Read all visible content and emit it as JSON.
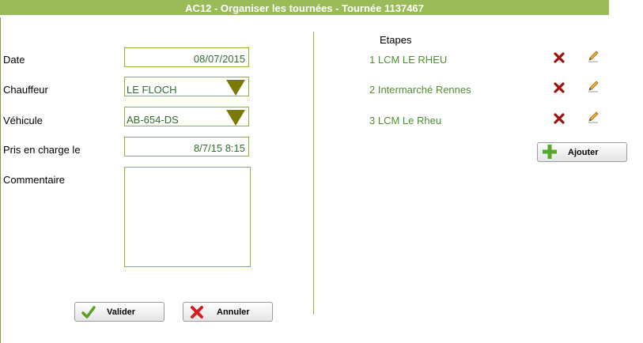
{
  "window": {
    "title": "AC12 - Organiser les tournées - Tournée 1137467"
  },
  "form": {
    "date_label": "Date",
    "date_value": "08/07/2015",
    "chauffeur_label": "Chauffeur",
    "chauffeur_value": "LE FLOCH",
    "vehicule_label": "Véhicule",
    "vehicule_value": "AB-654-DS",
    "pris_label": "Pris en charge le",
    "pris_value": "8/7/15 8:15",
    "commentaire_label": "Commentaire",
    "commentaire_value": ""
  },
  "etapes": {
    "title": "Etapes",
    "items": [
      {
        "label": "1  LCM LE RHEU"
      },
      {
        "label": "2 Intermarché Rennes"
      },
      {
        "label": "3 LCM Le Rheu"
      }
    ],
    "add_label": "Ajouter"
  },
  "buttons": {
    "validate_label": "Valider",
    "cancel_label": "Annuler"
  },
  "colors": {
    "titlebar": "#9bbb59",
    "field_border": "#8db43a",
    "step_text": "#4f8f2f",
    "combo_arrow": "#7a7a00",
    "delete_icon": "#a01010"
  }
}
